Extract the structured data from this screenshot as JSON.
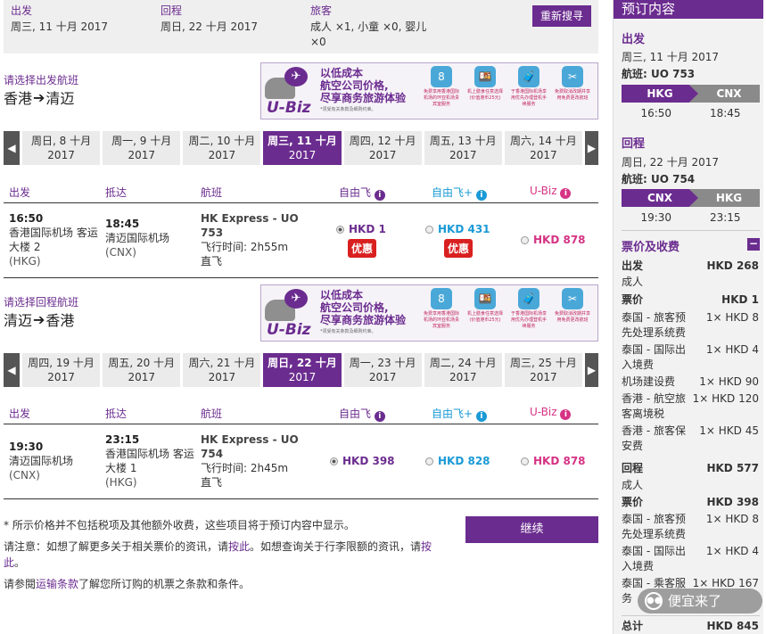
{
  "search": {
    "depart_label": "出发",
    "depart_value": "周三, 11 十月 2017",
    "return_label": "回程",
    "return_value": "周日, 22 十月 2017",
    "pax_label": "旅客",
    "pax_value": "成人 ×1, 小童 ×0, 婴儿 ×0",
    "research_button": "重新搜寻"
  },
  "outbound": {
    "choose_label": "请选择出发航班",
    "from": "香港",
    "to": "清迈",
    "dates": [
      {
        "day": "周日, 8 十月",
        "year": "2017"
      },
      {
        "day": "周一, 9 十月",
        "year": "2017"
      },
      {
        "day": "周二, 10 十月",
        "year": "2017"
      },
      {
        "day": "周三, 11 十月",
        "year": "2017",
        "active": true
      },
      {
        "day": "周四, 12 十月",
        "year": "2017"
      },
      {
        "day": "周五, 13 十月",
        "year": "2017"
      },
      {
        "day": "周六, 14 十月",
        "year": "2017"
      }
    ],
    "flight": {
      "dep_time": "16:50",
      "dep_airport": "香港国际机场 客运大楼 2",
      "dep_code": "(HKG)",
      "arr_time": "18:45",
      "arr_airport": "清迈国际机场",
      "arr_code": "(CNX)",
      "flight_name": "HK Express - UO 753",
      "duration": "飞行时间: 2h55m",
      "direct": "直飞",
      "fare": "HKD 1",
      "fare_plus": "HKD 431",
      "ubiz": "HKD 878",
      "promo": "优惠"
    }
  },
  "inbound": {
    "choose_label": "请选择回程航班",
    "from": "清迈",
    "to": "香港",
    "dates": [
      {
        "day": "周四, 19 十月",
        "year": "2017"
      },
      {
        "day": "周五, 20 十月",
        "year": "2017"
      },
      {
        "day": "周六, 21 十月",
        "year": "2017"
      },
      {
        "day": "周日, 22 十月",
        "year": "2017",
        "active": true
      },
      {
        "day": "周一, 23 十月",
        "year": "2017"
      },
      {
        "day": "周二, 24 十月",
        "year": "2017"
      },
      {
        "day": "周三, 25 十月",
        "year": "2017"
      }
    ],
    "flight": {
      "dep_time": "19:30",
      "dep_airport": "清迈国际机场",
      "dep_code": "(CNX)",
      "arr_time": "23:15",
      "arr_airport": "香港国际机场 客运大楼 1",
      "arr_code": "(HKG)",
      "flight_name": "HK Express - UO 754",
      "duration": "飞行时间: 2h45m",
      "direct": "直飞",
      "fare": "HKD 398",
      "fare_plus": "HKD 828",
      "ubiz": "HKD 878"
    }
  },
  "table_headers": {
    "depart": "出发",
    "arrive": "抵达",
    "flight": "航班",
    "fare": "自由飞",
    "fare_plus": "自由飞+",
    "ubiz": "U-Biz"
  },
  "banner": {
    "logo": "U-Biz",
    "line1": "以低成本",
    "line2": "航空公司价格,",
    "line3": "尽享商务旅游体验",
    "small": "*须受有关条款及细则约束。",
    "icons": [
      {
        "glyph": "8",
        "cap": "免费享用香港国际机场的环亚机场贵宾室服务"
      },
      {
        "glyph": "🍱",
        "cap": "机上膳食任意选择(价值港币25元)"
      },
      {
        "glyph": "🧳",
        "cap": "于香港国际机场享用优先办理登机手续服务"
      },
      {
        "glyph": "✂",
        "cap": "免费取消改期并享用免费更改航班"
      }
    ]
  },
  "notes": {
    "line1": "* 所示价格并不包括税项及其他额外收费，这些项目将于预订内容中显示。",
    "line2a": "请注意：如想了解更多关于相关票价的资讯，请",
    "line2link1": "按此",
    "line2b": "。如想查询关于行李限额的资讯，请",
    "line2link2": "按此",
    "line2c": "。",
    "line3a": "请参閱",
    "line3link": "运输条款",
    "line3b": "了解您所订购的机票之条款和条件。",
    "continue_button": "继续"
  },
  "sidebar": {
    "title": "预订内容",
    "outbound_label": "出发",
    "outbound_date": "周三, 11 十月 2017",
    "outbound_flight": "航班: UO 753",
    "ob_from": "HKG",
    "ob_to": "CNX",
    "ob_dep": "16:50",
    "ob_arr": "18:45",
    "return_label": "回程",
    "return_date": "周日, 22 十月 2017",
    "return_flight": "航班: UO 754",
    "rt_from": "CNX",
    "rt_to": "HKG",
    "rt_dep": "19:30",
    "rt_arr": "23:15",
    "price_label": "票价及收费",
    "ob_total_label": "出发",
    "ob_total": "HKD 268",
    "adult": "成人",
    "fare_label": "票价",
    "ob_fare": "HKD 1",
    "ob_items": [
      {
        "label": "泰国 - 旅客预先处理系统费",
        "value": "1× HKD 8"
      },
      {
        "label": "泰国 - 国际出入境费",
        "value": "1× HKD 4"
      },
      {
        "label": "机场建设费",
        "value": "1× HKD 90"
      },
      {
        "label": "香港 - 航空旅客离境税",
        "value": "1× HKD 120"
      },
      {
        "label": "香港 - 旅客保安费",
        "value": "1× HKD 45"
      }
    ],
    "rt_total_label": "回程",
    "rt_total": "HKD 577",
    "rt_fare": "HKD 398",
    "rt_items": [
      {
        "label": "泰国 - 旅客预先处理系统费",
        "value": "1× HKD 8"
      },
      {
        "label": "泰国 - 国际出入境费",
        "value": "1× HKD 4"
      },
      {
        "label": "泰国 - 乘客服务",
        "value": "1× HKD 167"
      }
    ],
    "grand_label": "总计",
    "grand_total": "HKD 845"
  },
  "watermark": "便宜来了"
}
